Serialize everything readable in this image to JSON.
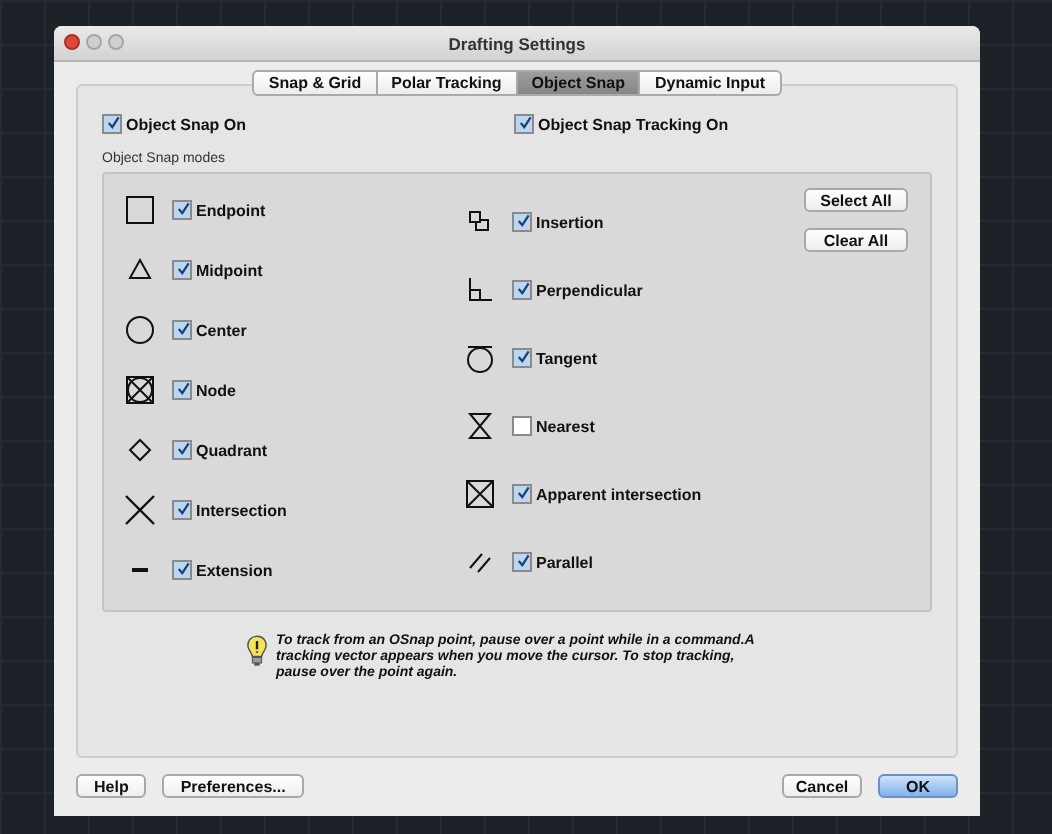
{
  "window": {
    "title": "Drafting Settings"
  },
  "tabs": [
    {
      "label": "Snap & Grid",
      "selected": false
    },
    {
      "label": "Polar Tracking",
      "selected": false
    },
    {
      "label": "Object Snap",
      "selected": true
    },
    {
      "label": "Dynamic Input",
      "selected": false
    }
  ],
  "options": [
    {
      "label": "Object Snap On",
      "checked": true
    },
    {
      "label": "Object Snap Tracking On",
      "checked": true
    }
  ],
  "modes_group": {
    "title": "Object Snap modes",
    "columns": [
      [
        {
          "kind": "square",
          "label": "Endpoint",
          "checked": true
        },
        {
          "kind": "triangle",
          "label": "Midpoint",
          "checked": true
        },
        {
          "kind": "circle",
          "label": "Center",
          "checked": true
        },
        {
          "kind": "node",
          "label": "Node",
          "checked": true
        },
        {
          "kind": "diamond",
          "label": "Quadrant",
          "checked": true
        },
        {
          "kind": "cross",
          "label": "Intersection",
          "checked": true
        },
        {
          "kind": "dash",
          "label": "Extension",
          "checked": true
        }
      ],
      [
        {
          "kind": "insertion",
          "label": "Insertion",
          "checked": true
        },
        {
          "kind": "perpendicular",
          "label": "Perpendicular",
          "checked": true
        },
        {
          "kind": "tangent",
          "label": "Tangent",
          "checked": true
        },
        {
          "kind": "hourglass",
          "label": "Nearest",
          "checked": false
        },
        {
          "kind": "boxcross",
          "label": "Apparent intersection",
          "checked": true
        },
        {
          "kind": "parallel",
          "label": "Parallel",
          "checked": true
        }
      ]
    ],
    "buttons": [
      "Select All",
      "Clear All"
    ]
  },
  "hint": "To track from an OSnap point, pause over a point while in a command.A tracking vector appears when you move the cursor. To stop tracking, pause over the point again.",
  "footer": {
    "left": [
      "Help",
      "Preferences..."
    ],
    "right": [
      {
        "label": "Cancel",
        "default": false
      },
      {
        "label": "OK",
        "default": true
      }
    ]
  }
}
